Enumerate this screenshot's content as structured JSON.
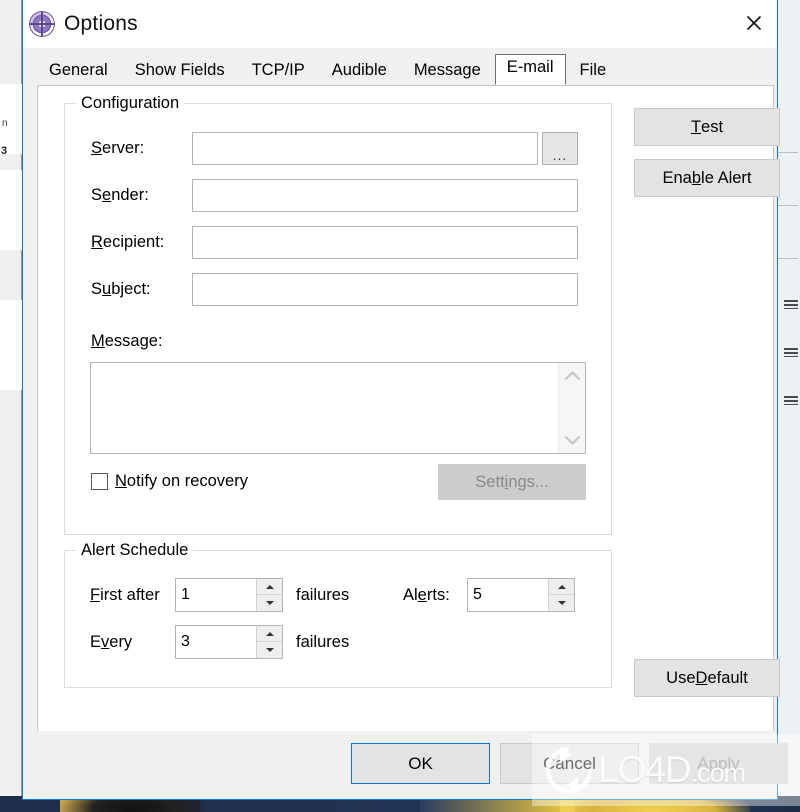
{
  "window": {
    "title": "Options",
    "icon": "target-circle-icon",
    "close_label": "✕",
    "accent_color": "#0078d7"
  },
  "tabs": [
    {
      "label": "General",
      "selected": false
    },
    {
      "label": "Show Fields",
      "selected": false
    },
    {
      "label": "TCP/IP",
      "selected": false
    },
    {
      "label": "Audible",
      "selected": false
    },
    {
      "label": "Message",
      "selected": false
    },
    {
      "label": "E-mail",
      "selected": true
    },
    {
      "label": "File",
      "selected": false
    }
  ],
  "configuration": {
    "group_title": "Configuration",
    "server": {
      "label_pre": "",
      "label_key": "S",
      "label_post": "erver:",
      "value": "",
      "placeholder": "",
      "browse_label": "...",
      "browse_name": "server-browse-button"
    },
    "sender": {
      "label_pre": "S",
      "label_key": "e",
      "label_post": "nder:",
      "value": "",
      "placeholder": ""
    },
    "recipient": {
      "label_pre": "",
      "label_key": "R",
      "label_post": "ecipient:",
      "value": "",
      "placeholder": ""
    },
    "subject": {
      "label_pre": "S",
      "label_key": "u",
      "label_post": "bject:",
      "value": "",
      "placeholder": ""
    },
    "message": {
      "label_pre": "",
      "label_key": "M",
      "label_post": "essage:",
      "value": "",
      "placeholder": "",
      "scroll_up_icon": "chevron-up-icon",
      "scroll_down_icon": "chevron-down-icon"
    },
    "notify_on_recovery": {
      "label_pre": "",
      "label_key": "N",
      "label_post": "otify on recovery",
      "checked": false
    },
    "settings_button": {
      "label_pre": "Sett",
      "label_key": "i",
      "label_post": "ngs...",
      "enabled": false
    }
  },
  "alert_schedule": {
    "group_title": "Alert Schedule",
    "first_after": {
      "label_pre": "",
      "label_key": "F",
      "label_post": "irst after",
      "value": "1",
      "unit": "failures"
    },
    "every": {
      "label_pre": "E",
      "label_key": "v",
      "label_post": "ery",
      "value": "3",
      "unit": "failures"
    },
    "alerts": {
      "label_pre": "Al",
      "label_key": "e",
      "label_post": "rts:",
      "value": "5"
    }
  },
  "side_buttons": {
    "test": {
      "label_pre": "",
      "label_key": "T",
      "label_post": "est"
    },
    "enable_alert": {
      "label_pre": "Ena",
      "label_key": "b",
      "label_post": "le Alert"
    },
    "use_default": {
      "label_pre": "Use ",
      "label_key": "D",
      "label_post": "efault"
    }
  },
  "command_bar": {
    "ok": "OK",
    "cancel": "Cancel",
    "apply": "Apply",
    "apply_enabled": false
  },
  "watermark": {
    "text": "LO4D",
    "suffix": ".com",
    "logo": "refresh-arrows-icon"
  }
}
